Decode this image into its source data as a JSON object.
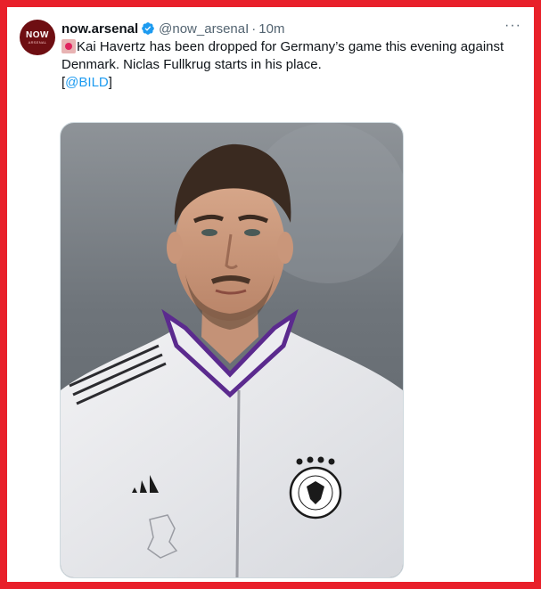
{
  "tweet": {
    "avatar_text": "NOW",
    "avatar_subtext": "ARSENAL",
    "display_name": "now.arsenal",
    "handle": "@now_arsenaI",
    "separator": "·",
    "time": "10m",
    "more_label": "···",
    "text_line": "Kai Havertz has been dropped for Germany’s game this evening against Denmark. Niclas Fullkrug starts in his place.",
    "mention_open": "[",
    "mention": "@BILD",
    "mention_close": "]"
  },
  "colors": {
    "frame": "#e8202a",
    "link": "#1d9bf0",
    "verified": "#1d9bf0",
    "name": "#0f1419",
    "secondary": "#536471"
  },
  "media": {
    "description_icon": "photo"
  }
}
